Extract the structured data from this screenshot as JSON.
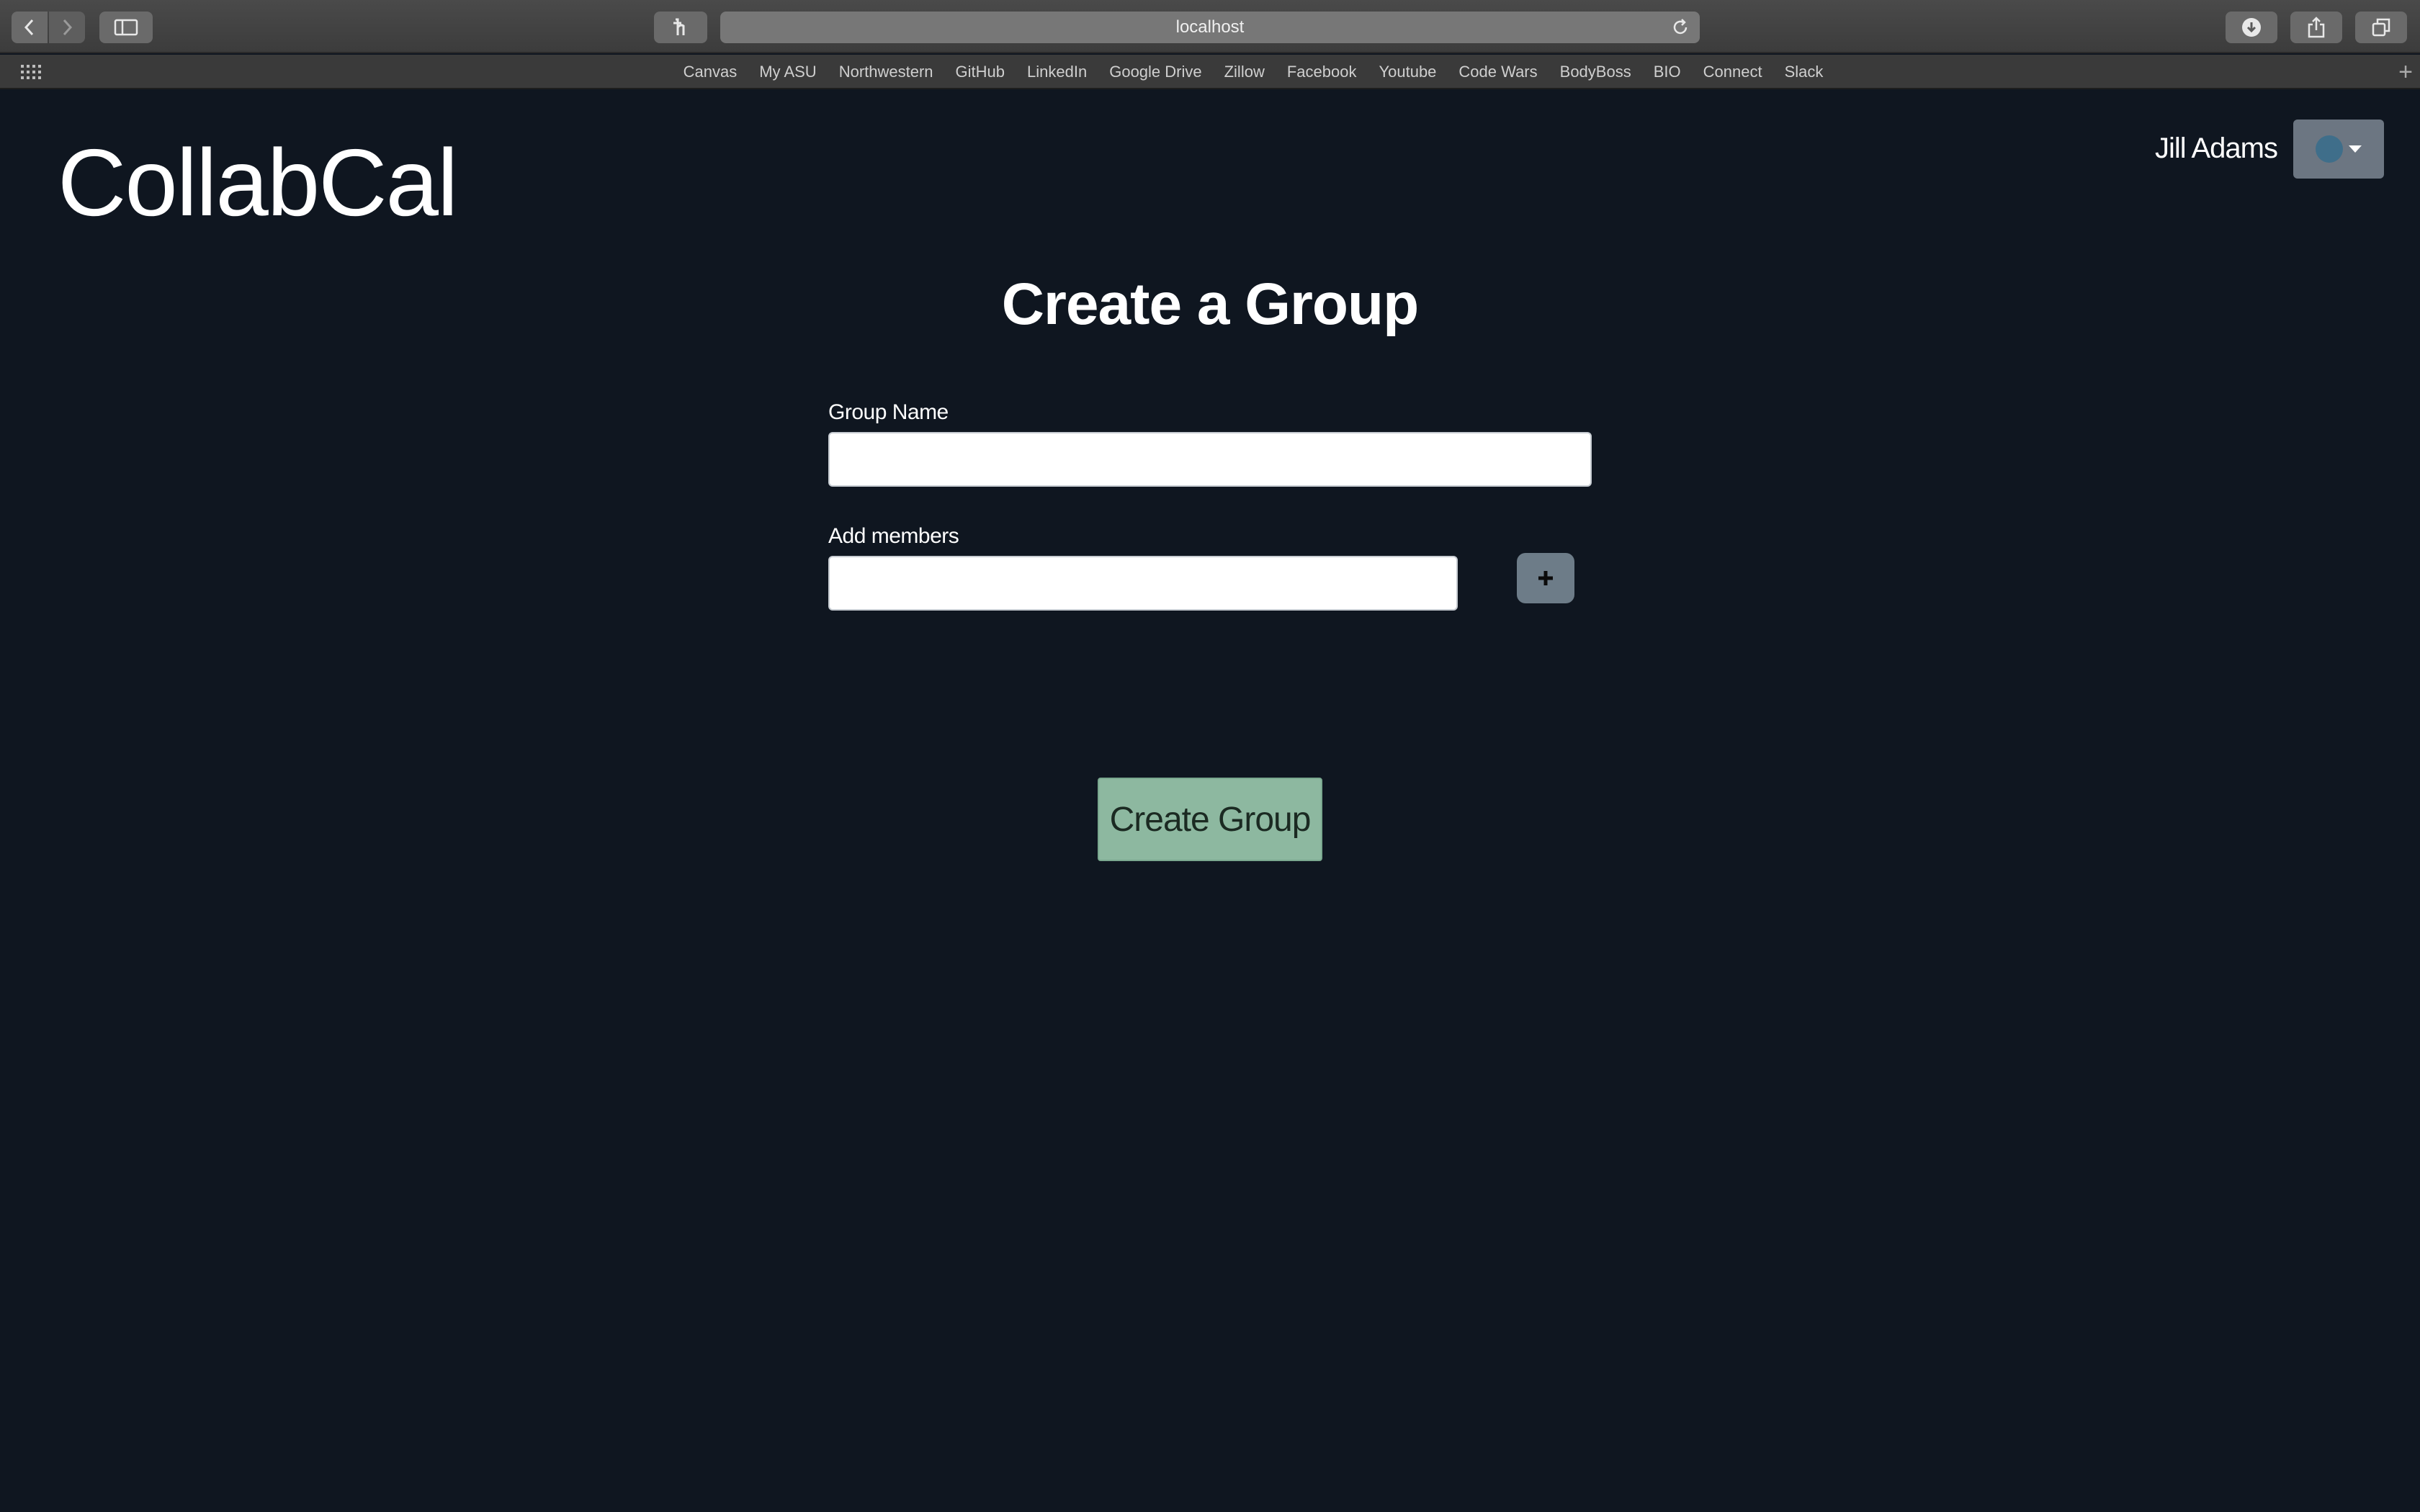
{
  "browser": {
    "address": "localhost",
    "bookmarks": [
      "Canvas",
      "My ASU",
      "Northwestern",
      "GitHub",
      "LinkedIn",
      "Google Drive",
      "Zillow",
      "Facebook",
      "Youtube",
      "Code Wars",
      "BodyBoss",
      "BIO",
      "Connect",
      "Slack"
    ],
    "icons": [
      "back-icon",
      "forward-icon",
      "sidebar-icon",
      "extension-icon",
      "reload-icon",
      "download-icon",
      "share-icon",
      "tabs-icon",
      "apps-grid-icon",
      "new-tab-plus-icon"
    ]
  },
  "app": {
    "brand": "CollabCal",
    "user": {
      "name": "Jill Adams"
    }
  },
  "form": {
    "title": "Create a Group",
    "group_name_label": "Group Name",
    "group_name_value": "",
    "members_label": "Add members",
    "members_value": "",
    "add_member_icon": "plus-icon",
    "submit_label": "Create Group"
  },
  "colors": {
    "page_background": "#0f1620",
    "submit_button": "#8db8a0",
    "add_button": "#6d7c88",
    "user_menu": "#6c7682"
  }
}
